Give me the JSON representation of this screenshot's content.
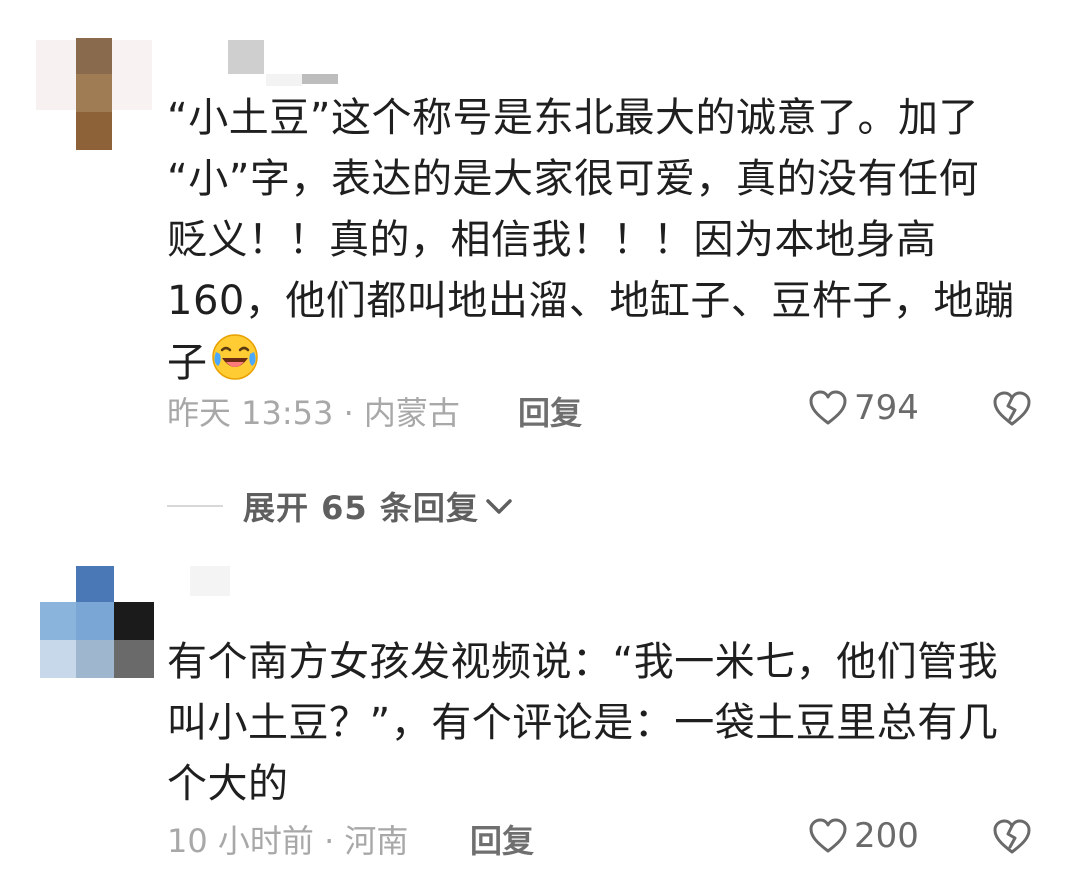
{
  "comments": [
    {
      "text": "“小土豆”这个称号是东北最大的诚意了。加了\n“小”字，表达的是大家很可爱，真的没有任何\n贬义！！真的，相信我！！！因为本地身高\n160，他们都叫地出溜、地缸子、豆杵子，地蹦\n子",
      "emoji": "laugh-crying-emoji",
      "meta": "昨天 13:53 · 内蒙古",
      "reply_label": "回复",
      "likes": "794",
      "expand_label": "展开 65 条回复"
    },
    {
      "text": "有个南方女孩发视频说：“我一米七，他们管我\n叫小土豆？”，有个评论是：一袋土豆里总有几\n个大的",
      "meta": "10 小时前 · 河南",
      "reply_label": "回复",
      "likes": "200"
    }
  ],
  "icons": {
    "like": "heart-outline-icon",
    "dislike": "broken-heart-icon",
    "expand": "chevron-down-icon"
  },
  "colors": {
    "text": "#1f1f1f",
    "meta": "#a8a8a8",
    "icon": "#6a6a6a"
  }
}
